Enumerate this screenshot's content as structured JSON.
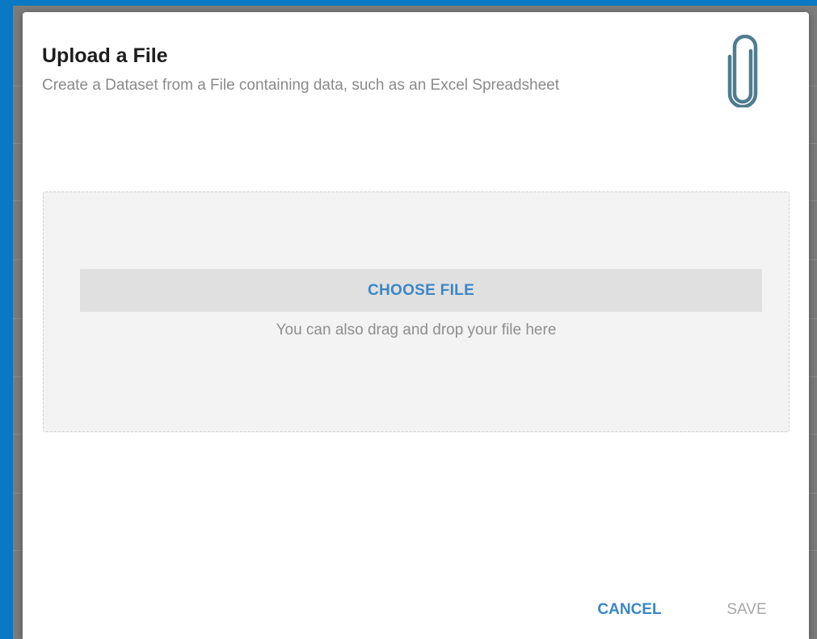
{
  "dialog": {
    "title": "Upload a File",
    "subtitle": "Create a Dataset from a File containing data, such as an Excel Spreadsheet",
    "icon": "paperclip-icon"
  },
  "dropzone": {
    "choose_label": "CHOOSE FILE",
    "drag_hint": "You can also drag and drop your file here"
  },
  "footer": {
    "cancel_label": "CANCEL",
    "save_label": "SAVE"
  },
  "colors": {
    "backdrop": "#0a78c2",
    "accent": "#3b86c6",
    "icon": "#4f7c8f",
    "disabled": "#a8a8a8"
  }
}
